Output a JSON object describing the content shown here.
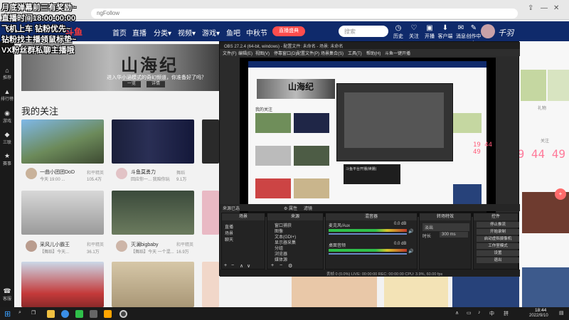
{
  "overlay": {
    "line1": "月底弹幕前三有奖励~",
    "line2": "直播时间18:00-00:00",
    "line3": "飞机上车 钻粉优先~",
    "line4": "钻粉找主播领鼠标垫~",
    "line5": "VX粉丝群私聊主播哦"
  },
  "browser": {
    "url": "ngFollow"
  },
  "site_nav": {
    "logo": "斗鱼",
    "items": [
      "首页",
      "直播",
      "分类▾",
      "视频▾",
      "游戏▾",
      "鱼吧",
      "中秋节"
    ],
    "hot_badge": "直播盛典",
    "search_placeholder": "搜索",
    "icons": [
      "历史",
      "关注",
      "开播",
      "客户端",
      "消息",
      "创作中心"
    ],
    "brand": "千羽"
  },
  "left_sidebar": [
    "推荐",
    "排行榜",
    "游戏",
    "三联",
    "赛事",
    "客服"
  ],
  "banner": {
    "title": "山海纪",
    "subtitle": "进入华小涵模式的奇幻频道，你准备好了吗？",
    "btn1": "一览",
    "btn2": "详情"
  },
  "follow_title": "我的关注",
  "cards": [
    {
      "name": "一曲小团团DoD",
      "desc": "今天 19:00 ...",
      "cat": "和平精英",
      "viewers": "105.4万"
    },
    {
      "name": "斗鱼莫勇力",
      "desc": "回应你一... 我陪你玩",
      "cat": "舞蹈",
      "viewers": "9.1万"
    },
    {
      "name": "采风儿小霸王",
      "desc": "【舞蹈】今天...",
      "cat": "和平精英",
      "viewers": "36.1万"
    },
    {
      "name": "灭澜bigbaby",
      "desc": "【舞蹈】今天 一个混...",
      "cat": "和平精英",
      "viewers": "16.9万"
    }
  ],
  "obs": {
    "title": "OBS 27.2.4 (64-bit, windows) - 配置文件: 未命名 - 场景: 未命名",
    "menu": [
      "文件(F)",
      "编辑(E)",
      "视图(V)",
      "停靠窗口(D)",
      "配置文件(P)",
      "场景集合(S)",
      "工具(T)",
      "帮助(H)",
      "斗鱼一键开播"
    ],
    "preview_title": "山海纪",
    "preview_follow": "我的关注",
    "nested_dialog": "斗鱼平台开播(续播)",
    "preview_clock": "19 44 49",
    "status_row": "来源已选",
    "gear_label": "⚙ 属性",
    "filter_label": "滤镜",
    "docks": {
      "scenes": {
        "title": "场景",
        "items": [
          "直播",
          "场景",
          "聊天"
        ]
      },
      "sources": {
        "title": "来源",
        "items": [
          "窗口捕获",
          "图像",
          "文本(GDI+)",
          "显示器采集",
          "分组",
          "浏览器",
          "媒体源"
        ]
      },
      "mixer": {
        "title": "混音器",
        "ch1": "麦克风/Aux",
        "ch2": "桌面音频",
        "db1": "0.0 dB",
        "db2": "0.0 dB"
      },
      "transitions": {
        "title": "转场特效",
        "type": "淡出",
        "duration_label": "时长",
        "duration": "300 ms"
      },
      "controls": {
        "title": "控件",
        "buttons": [
          "停止推流",
          "开始录制",
          "启动虚拟摄像机",
          "工作室模式",
          "设置",
          "退出"
        ]
      }
    },
    "footer": "丢帧 0 (0.0%)   LIVE: 00:00:00   REC: 00:00:00   CPU: 3.9%, 60.00 fps"
  },
  "right_clock": "19 44 49",
  "right_labels": [
    "关注",
    "礼物",
    "关注"
  ],
  "fab": "+",
  "taskbar": {
    "time": "18:44",
    "date": "2022/9/10"
  }
}
